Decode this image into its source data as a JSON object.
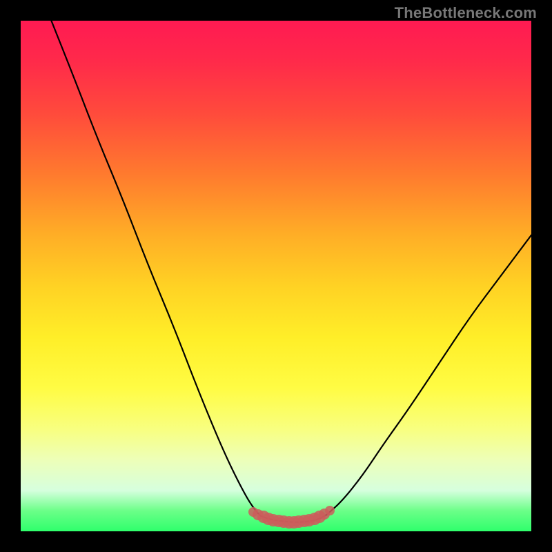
{
  "watermark": "TheBottleneck.com",
  "colors": {
    "background": "#000000",
    "curve_stroke": "#000000",
    "marker_fill": "rgba(205,92,92,0.85)",
    "gradient_top": "#ff1a52",
    "gradient_bottom": "#2fff6c"
  },
  "chart_data": {
    "type": "line",
    "title": "",
    "xlabel": "",
    "ylabel": "",
    "xlim": [
      0,
      100
    ],
    "ylim": [
      0,
      100
    ],
    "notes": "V-shaped bottleneck curve over a vertical rainbow gradient (red=high bottleneck at top, green=low at bottom). Flat minimum around x≈47–60 with salmon dot markers along the basin.",
    "series": [
      {
        "name": "curve_left",
        "x": [
          6,
          10,
          15,
          20,
          25,
          30,
          35,
          40,
          44,
          46,
          47
        ],
        "y": [
          100,
          90,
          77,
          65,
          52,
          40,
          27,
          15,
          7,
          4,
          3
        ]
      },
      {
        "name": "curve_basin",
        "x": [
          47,
          49,
          51,
          53,
          55,
          57,
          58,
          59,
          60
        ],
        "y": [
          3,
          2.3,
          2,
          1.8,
          1.8,
          2,
          2.3,
          2.7,
          3.3
        ]
      },
      {
        "name": "curve_right",
        "x": [
          60,
          63,
          67,
          71,
          76,
          82,
          88,
          94,
          100
        ],
        "y": [
          3.3,
          6,
          11,
          17,
          24,
          33,
          42,
          50,
          58
        ]
      }
    ],
    "markers": {
      "name": "optimal_range_dots",
      "x": [
        45.5,
        46.5,
        47.5,
        48.5,
        49.5,
        50.5,
        51.5,
        52.5,
        53.5,
        54.5,
        55.5,
        56.5,
        57.5,
        58.5,
        59.5,
        60.5
      ],
      "y": [
        3.8,
        3.2,
        2.8,
        2.5,
        2.2,
        2.0,
        1.9,
        1.8,
        1.8,
        1.9,
        2.0,
        2.2,
        2.5,
        2.9,
        3.4,
        4.0
      ],
      "r": [
        7,
        8,
        9,
        9,
        9,
        9,
        9,
        9,
        9,
        9,
        9,
        9,
        9,
        9,
        8,
        7
      ]
    }
  }
}
